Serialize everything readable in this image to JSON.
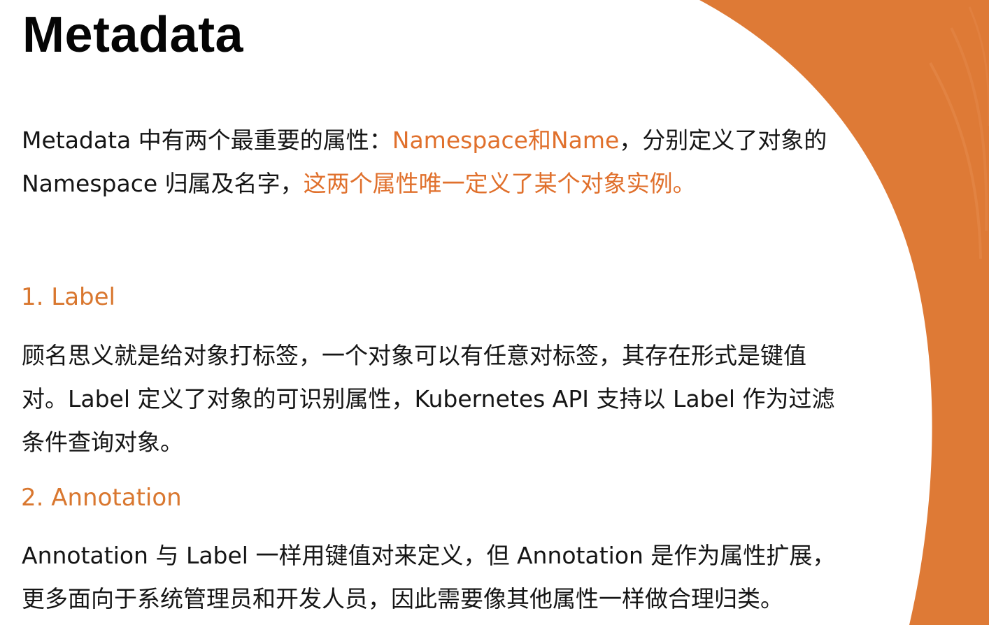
{
  "slide": {
    "title": "Metadata",
    "intro": {
      "line1_text1": "Metadata 中有两个最重要的属性：",
      "line1_highlight": "Namespace和Name",
      "line1_text2": "，分别定义了对象的",
      "line2_text1": "Namespace 归属及名字，",
      "line2_highlight": "这两个属性唯一定义了某个对象实例。"
    },
    "sections": [
      {
        "heading": "1. Label",
        "lines": [
          "顾名思义就是给对象打标签，一个对象可以有任意对标签，其存在形式是键值",
          "对。Label 定义了对象的可识别属性，Kubernetes API 支持以 Label 作为过滤",
          "条件查询对象。"
        ]
      },
      {
        "heading": "2. Annotation",
        "lines": [
          "Annotation 与 Label 一样用键值对来定义，但 Annotation 是作为属性扩展，",
          "更多面向于系统管理员和开发人员，因此需要像其他属性一样做合理归类。"
        ]
      }
    ],
    "colors": {
      "accent": "#e0702c",
      "background_arc": "#de7a36",
      "text": "#151515"
    }
  }
}
